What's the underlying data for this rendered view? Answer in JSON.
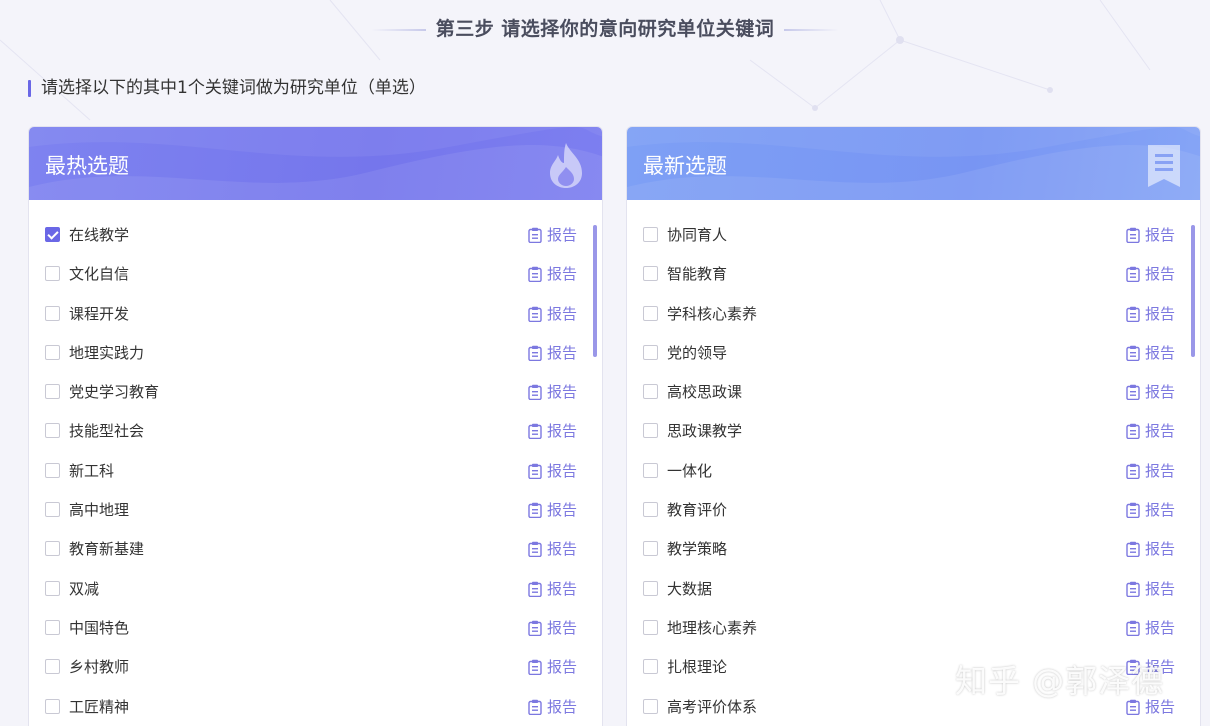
{
  "step_title": "第三步 请选择你的意向研究单位关键词",
  "instruction": "请选择以下的其中1个关键词做为研究单位（单选）",
  "colors": {
    "accent": "#6a67e6",
    "hot_header": "#7576ec",
    "new_header": "#7895f3",
    "report_link": "#7c78e0"
  },
  "report_label": "报告",
  "hot_panel": {
    "title": "最热选题",
    "icon": "flame-icon",
    "items": [
      {
        "label": "在线教学",
        "checked": true
      },
      {
        "label": "文化自信",
        "checked": false
      },
      {
        "label": "课程开发",
        "checked": false
      },
      {
        "label": "地理实践力",
        "checked": false
      },
      {
        "label": "党史学习教育",
        "checked": false
      },
      {
        "label": "技能型社会",
        "checked": false
      },
      {
        "label": "新工科",
        "checked": false
      },
      {
        "label": "高中地理",
        "checked": false
      },
      {
        "label": "教育新基建",
        "checked": false
      },
      {
        "label": "双减",
        "checked": false
      },
      {
        "label": "中国特色",
        "checked": false
      },
      {
        "label": "乡村教师",
        "checked": false
      },
      {
        "label": "工匠精神",
        "checked": false
      }
    ]
  },
  "new_panel": {
    "title": "最新选题",
    "icon": "document-icon",
    "items": [
      {
        "label": "协同育人",
        "checked": false
      },
      {
        "label": "智能教育",
        "checked": false
      },
      {
        "label": "学科核心素养",
        "checked": false
      },
      {
        "label": "党的领导",
        "checked": false
      },
      {
        "label": "高校思政课",
        "checked": false
      },
      {
        "label": "思政课教学",
        "checked": false
      },
      {
        "label": "一体化",
        "checked": false
      },
      {
        "label": "教育评价",
        "checked": false
      },
      {
        "label": "教学策略",
        "checked": false
      },
      {
        "label": "大数据",
        "checked": false
      },
      {
        "label": "地理核心素养",
        "checked": false
      },
      {
        "label": "扎根理论",
        "checked": false
      },
      {
        "label": "高考评价体系",
        "checked": false
      }
    ]
  },
  "watermark": "知乎 @郭泽德"
}
